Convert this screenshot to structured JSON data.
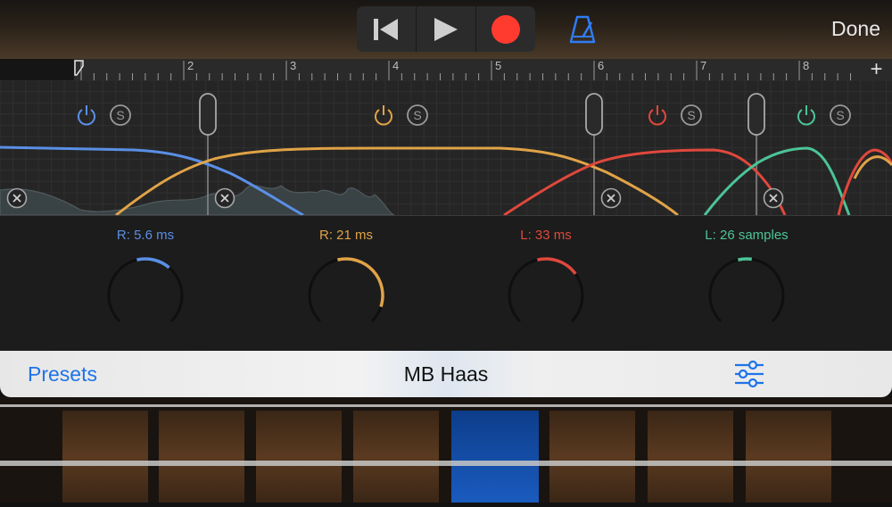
{
  "header": {
    "done_label": "Done",
    "transport": [
      {
        "name": "rewind",
        "icon": "rewind-to-start-icon"
      },
      {
        "name": "play",
        "icon": "play-icon"
      },
      {
        "name": "record",
        "icon": "record-icon",
        "color": "#ff3b30"
      }
    ],
    "metronome_icon": "metronome-icon",
    "metronome_color": "#2f7cf6"
  },
  "ruler": {
    "bars": [
      "2",
      "3",
      "4",
      "5",
      "6",
      "7",
      "8"
    ],
    "add_label": "+"
  },
  "bands": [
    {
      "label": "R: 5.6 ms",
      "color": "#5a8fe6",
      "knob_level": 0.2
    },
    {
      "label": "R: 21 ms",
      "color": "#e0a347",
      "knob_level": 0.45
    },
    {
      "label": "L: 33 ms",
      "color": "#e0483c",
      "knob_level": 0.25
    },
    {
      "label": "L: 26 samples",
      "color": "#4cc497",
      "knob_level": 0.08
    }
  ],
  "footer": {
    "presets_label": "Presets",
    "title": "MB Haas",
    "settings_icon": "sliders-icon"
  }
}
